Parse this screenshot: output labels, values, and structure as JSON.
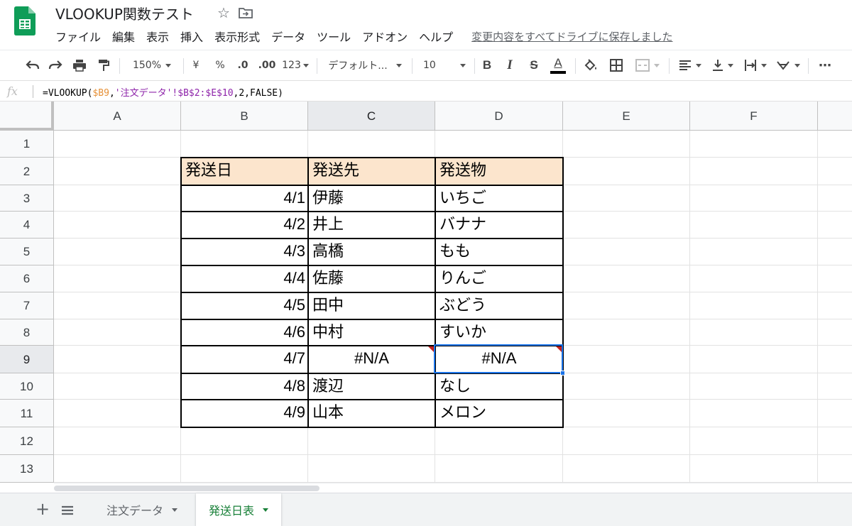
{
  "document": {
    "title": "VLOOKUP関数テスト",
    "save_status": "変更内容をすべてドライブに保存しました"
  },
  "menu": [
    "ファイル",
    "編集",
    "表示",
    "挿入",
    "表示形式",
    "データ",
    "ツール",
    "アドオン",
    "ヘルプ"
  ],
  "toolbar": {
    "zoom": "150%",
    "currency": "¥",
    "percent": "%",
    "decrease_decimal": ".0",
    "increase_decimal": ".00",
    "more_formats": "123",
    "font": "デフォルト...",
    "font_size": "10",
    "bold": "B",
    "italic": "I",
    "strike": "S",
    "text_color": "A",
    "more": "⋯"
  },
  "formula_bar": {
    "fx": "fx",
    "formula_prefix": "=VLOOKUP(",
    "formula_ref1": "$B9",
    "formula_comma1": ",",
    "formula_sheet": "'注文データ'",
    "formula_range": "!$B$2:$E$10",
    "formula_rest": ",2,FALSE)"
  },
  "grid": {
    "columns": [
      "A",
      "B",
      "C",
      "D",
      "E",
      "F"
    ],
    "rows": [
      "1",
      "2",
      "3",
      "4",
      "5",
      "6",
      "7",
      "8",
      "9",
      "10",
      "11",
      "12",
      "13"
    ],
    "selected_cell": "C9"
  },
  "table": {
    "headers": [
      "発送日",
      "発送先",
      "発送物"
    ],
    "rows": [
      [
        "4/1",
        "伊藤",
        "いちご"
      ],
      [
        "4/2",
        "井上",
        "バナナ"
      ],
      [
        "4/3",
        "高橋",
        "もも"
      ],
      [
        "4/4",
        "佐藤",
        "りんご"
      ],
      [
        "4/5",
        "田中",
        "ぶどう"
      ],
      [
        "4/6",
        "中村",
        "すいか"
      ],
      [
        "4/7",
        "#N/A",
        "#N/A"
      ],
      [
        "4/8",
        "渡辺",
        "なし"
      ],
      [
        "4/9",
        "山本",
        "メロン"
      ]
    ],
    "header_fill": "#fce5cd",
    "error_marker_color": "#c5221f"
  },
  "sheets": {
    "add": "+",
    "tabs": [
      {
        "label": "注文データ",
        "active": false
      },
      {
        "label": "発送日表",
        "active": true
      }
    ],
    "active_color": "#188038"
  },
  "colors": {
    "selection": "#1a73e8",
    "sheets_green": "#0f9d58"
  }
}
